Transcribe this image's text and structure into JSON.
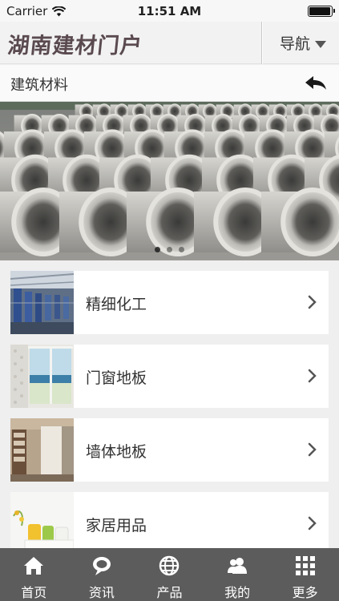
{
  "status_bar": {
    "carrier": "Carrier",
    "time": "11:51 AM",
    "battery_level": 0.95
  },
  "header": {
    "logo": "湖南建材门户",
    "nav_label": "导航",
    "logo_color": "#5a4a4f"
  },
  "subheader": {
    "title": "建筑材料",
    "back_icon": "back-arrow-icon"
  },
  "banner": {
    "dots": 3,
    "active_dot": 0,
    "subject": "concrete-pipes"
  },
  "list": [
    {
      "label": "精细化工",
      "icon": "chevron-right-icon"
    },
    {
      "label": "门窗地板",
      "icon": "chevron-right-icon"
    },
    {
      "label": "墙体地板",
      "icon": "chevron-right-icon"
    },
    {
      "label": "家居用品",
      "icon": "chevron-right-icon"
    }
  ],
  "tabbar": {
    "background": "#5c5c5c",
    "tabs": [
      {
        "label": "首页",
        "icon": "home-icon"
      },
      {
        "label": "资讯",
        "icon": "chat-bubble-icon"
      },
      {
        "label": "产品",
        "icon": "globe-icon"
      },
      {
        "label": "我的",
        "icon": "users-icon"
      },
      {
        "label": "更多",
        "icon": "grid-icon"
      }
    ]
  }
}
